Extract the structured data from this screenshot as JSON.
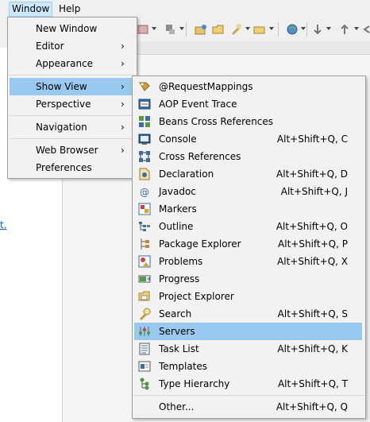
{
  "menubar": {
    "items": [
      {
        "label": "Window",
        "active": true
      },
      {
        "label": "Help",
        "active": false
      }
    ]
  },
  "left_panel": {
    "link_text": "t."
  },
  "window_menu": {
    "items": [
      {
        "label": "New Window",
        "submenu": false
      },
      {
        "label": "Editor",
        "submenu": true
      },
      {
        "label": "Appearance",
        "submenu": true
      },
      {
        "label": "Show View",
        "submenu": true,
        "highlighted": true
      },
      {
        "label": "Perspective",
        "submenu": true
      },
      {
        "label": "Navigation",
        "submenu": true
      },
      {
        "label": "Web Browser",
        "submenu": true
      },
      {
        "label": "Preferences",
        "submenu": false
      }
    ],
    "arrow": "›"
  },
  "show_view_menu": {
    "items": [
      {
        "label": "@RequestMappings",
        "shortcut": "",
        "icon": "request-mappings-icon"
      },
      {
        "label": "AOP Event Trace",
        "shortcut": "",
        "icon": "aop-event-trace-icon"
      },
      {
        "label": "Beans Cross References",
        "shortcut": "",
        "icon": "beans-cross-references-icon"
      },
      {
        "label": "Console",
        "shortcut": "Alt+Shift+Q, C",
        "icon": "console-icon"
      },
      {
        "label": "Cross References",
        "shortcut": "",
        "icon": "cross-references-icon"
      },
      {
        "label": "Declaration",
        "shortcut": "Alt+Shift+Q, D",
        "icon": "declaration-icon"
      },
      {
        "label": "Javadoc",
        "shortcut": "Alt+Shift+Q, J",
        "icon": "javadoc-icon"
      },
      {
        "label": "Markers",
        "shortcut": "",
        "icon": "markers-icon"
      },
      {
        "label": "Outline",
        "shortcut": "Alt+Shift+Q, O",
        "icon": "outline-icon"
      },
      {
        "label": "Package Explorer",
        "shortcut": "Alt+Shift+Q, P",
        "icon": "package-explorer-icon"
      },
      {
        "label": "Problems",
        "shortcut": "Alt+Shift+Q, X",
        "icon": "problems-icon"
      },
      {
        "label": "Progress",
        "shortcut": "",
        "icon": "progress-icon"
      },
      {
        "label": "Project Explorer",
        "shortcut": "",
        "icon": "project-explorer-icon"
      },
      {
        "label": "Search",
        "shortcut": "Alt+Shift+Q, S",
        "icon": "search-icon"
      },
      {
        "label": "Servers",
        "shortcut": "",
        "icon": "servers-icon",
        "highlighted": true
      },
      {
        "label": "Task List",
        "shortcut": "Alt+Shift+Q, K",
        "icon": "task-list-icon"
      },
      {
        "label": "Templates",
        "shortcut": "",
        "icon": "templates-icon"
      },
      {
        "label": "Type Hierarchy",
        "shortcut": "Alt+Shift+Q, T",
        "icon": "type-hierarchy-icon"
      },
      {
        "label": "Other...",
        "shortcut": "Alt+Shift+Q, Q",
        "icon": ""
      }
    ]
  },
  "colors": {
    "highlight": "#99c9ef",
    "menu_bg": "#f2f2f2",
    "menubar_active": "#cce8ff"
  }
}
